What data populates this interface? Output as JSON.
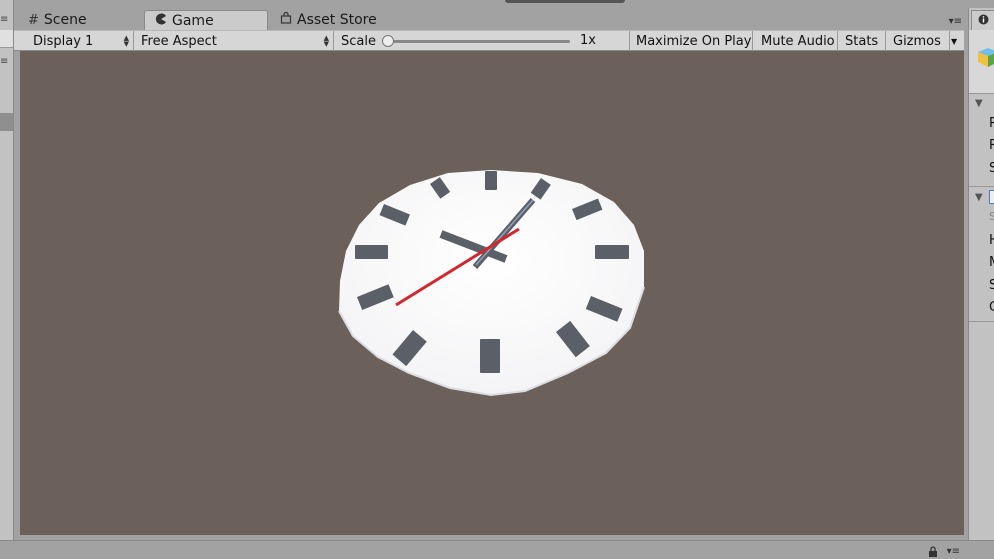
{
  "tabs": {
    "scene": {
      "label": "Scene",
      "icon": "grid-icon"
    },
    "game": {
      "label": "Game",
      "icon": "pacman-icon"
    },
    "asset_store": {
      "label": "Asset Store",
      "icon": "shopping-bag-icon"
    }
  },
  "toolbar": {
    "display": "Display 1",
    "aspect": "Free Aspect",
    "scale_label": "Scale",
    "scale_value": "1x",
    "scale_fraction": 0.0,
    "maximize_on_play": "Maximize On Play",
    "mute_audio": "Mute Audio",
    "stats": "Stats",
    "gizmos": "Gizmos"
  },
  "inspector": {
    "rows_top": [
      "P",
      "R",
      "S"
    ],
    "rows_bottom": [
      "S",
      "H",
      "M",
      "S",
      "C"
    ]
  },
  "colors": {
    "game_background": "#6b615a",
    "clock_face": "#ffffff",
    "hour_markers": "#5b6068",
    "second_hand": "#d0282c",
    "minute_hand": "#5b6068",
    "hour_hand": "#5b6068"
  }
}
